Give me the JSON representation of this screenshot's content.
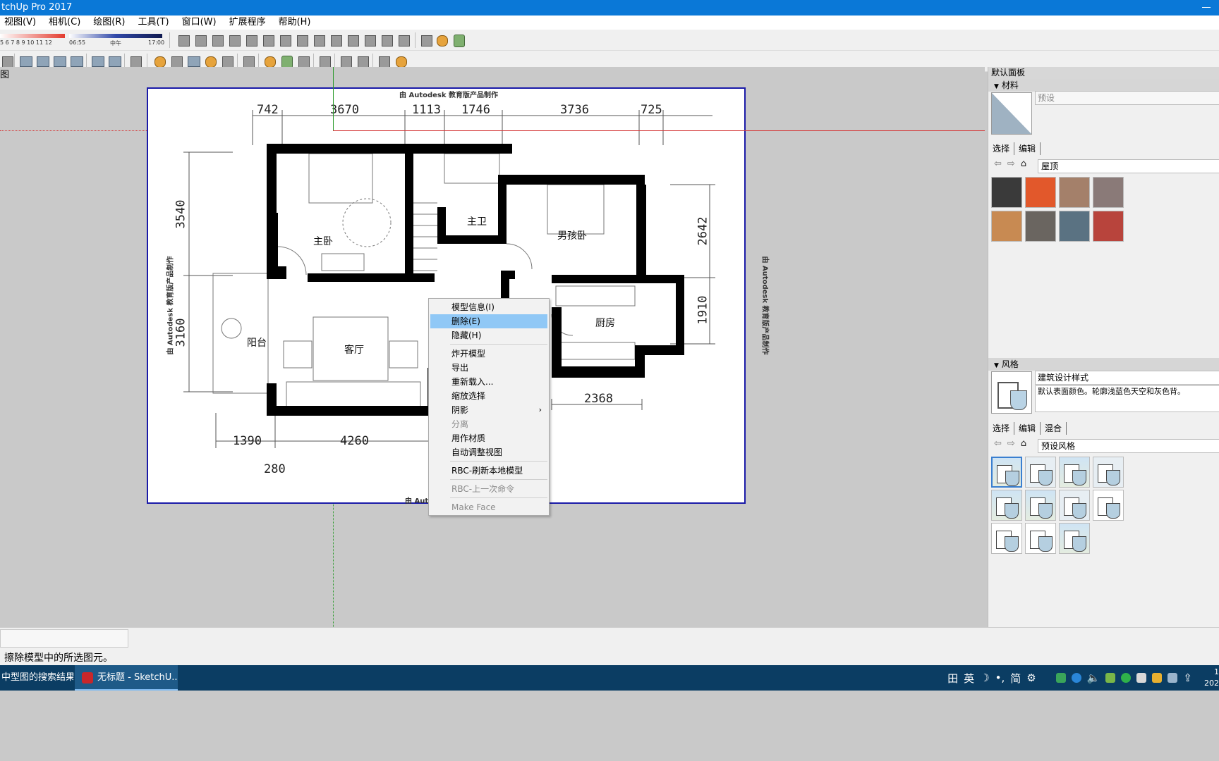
{
  "window": {
    "title": "tchUp Pro 2017"
  },
  "menu": {
    "items": [
      "视图(V)",
      "相机(C)",
      "绘图(R)",
      "工具(T)",
      "窗口(W)",
      "扩展程序",
      "帮助(H)"
    ]
  },
  "shadow_toolbar": {
    "month_labels": "5  6  7  8  9  10 11 12",
    "time_start": "06:55",
    "time_mid": "中午",
    "time_end": "17:00"
  },
  "viewport": {
    "scene_tab": "图"
  },
  "drawing": {
    "watermark": "由 Autodesk 教育版产品制作",
    "watermark_bottom": "由 Autodesk 教育版产品制作",
    "dims_top": [
      "742",
      "3670",
      "1113",
      "1746",
      "3736",
      "725"
    ],
    "dims_bottom": [
      "1390",
      "4260",
      "280",
      "2368"
    ],
    "dims_left": [
      "3540",
      "3160"
    ],
    "dims_right": [
      "2642",
      "1910"
    ],
    "rooms": {
      "master_bed": "主卧",
      "master_bath": "主卫",
      "boy_room": "男孩卧",
      "balcony": "阳台",
      "living": "客厅",
      "kitchen": "厨房"
    }
  },
  "context_menu": {
    "items": [
      {
        "label": "模型信息(I)"
      },
      {
        "label": "删除(E)"
      },
      {
        "label": "隐藏(H)"
      },
      {
        "label": "炸开模型"
      },
      {
        "label": "导出"
      },
      {
        "label": "重新载入..."
      },
      {
        "label": "缩放选择"
      },
      {
        "label": "阴影",
        "arrow": "›"
      },
      {
        "label": "分离"
      },
      {
        "label": "用作材质"
      },
      {
        "label": "自动调整视图"
      },
      {
        "label": "RBC-刷新本地模型"
      },
      {
        "label": "RBC-上一次命令"
      },
      {
        "label": "Make Face"
      }
    ]
  },
  "tray_panel": {
    "title": "默认面板",
    "materials": {
      "header": "材料",
      "name_placeholder": "预设",
      "tabs": [
        "选择",
        "编辑"
      ],
      "category": "屋顶",
      "swatch_colors": [
        "#3a3a3a",
        "#e2582b",
        "#a4806a",
        "#8a7a78",
        "#c88a52",
        "#6a6560",
        "#5a7282",
        "#b8443c"
      ]
    },
    "styles": {
      "header": "风格",
      "style_name": "建筑设计样式",
      "description": "默认表面颜色。轮廓浅蓝色天空和灰色背。",
      "tabs": [
        "选择",
        "编辑",
        "混合"
      ],
      "category": "预设风格"
    }
  },
  "status": {
    "message": "擦除模型中的所选图元。"
  },
  "taskbar": {
    "tasks": [
      {
        "label": "中型图的搜索结果_..."
      },
      {
        "label": "无标题 - SketchU..."
      }
    ],
    "tray": {
      "ime_grid": "田",
      "ime_lang": "英",
      "ime_simp": "简",
      "clock_time": "1",
      "clock_date": "202"
    }
  }
}
